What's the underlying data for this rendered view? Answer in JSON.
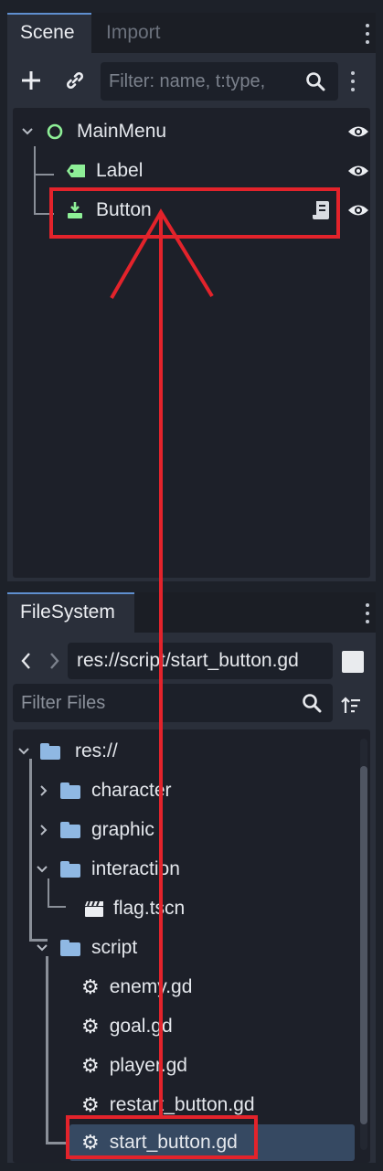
{
  "scene_dock": {
    "tabs": [
      {
        "label": "Scene"
      },
      {
        "label": "Import"
      }
    ],
    "filter_placeholder": "Filter: name, t:type,",
    "tree": [
      {
        "label": "MainMenu",
        "icon": "control-node-icon"
      },
      {
        "label": "Label",
        "icon": "label-node-icon"
      },
      {
        "label": "Button",
        "icon": "button-node-icon",
        "has_script": true
      }
    ]
  },
  "filesystem_dock": {
    "tab_label": "FileSystem",
    "path": "res://script/start_button.gd",
    "filter_placeholder": "Filter Files",
    "tree": [
      {
        "label": "res://",
        "type": "folder"
      },
      {
        "label": "character",
        "type": "folder"
      },
      {
        "label": "graphic",
        "type": "folder"
      },
      {
        "label": "interaction",
        "type": "folder"
      },
      {
        "label": "flag.tscn",
        "type": "scene"
      },
      {
        "label": "script",
        "type": "folder"
      },
      {
        "label": "enemy.gd",
        "type": "script"
      },
      {
        "label": "goal.gd",
        "type": "script"
      },
      {
        "label": "player.gd",
        "type": "script"
      },
      {
        "label": "restart_button.gd",
        "type": "script"
      },
      {
        "label": "start_button.gd",
        "type": "script",
        "selected": true
      }
    ]
  },
  "colors": {
    "annotation": "#e3232b",
    "node_green": "#8eef97",
    "folder_blue": "#8fb8e3",
    "accent": "#5f8fcf",
    "selected_row": "#364962"
  }
}
